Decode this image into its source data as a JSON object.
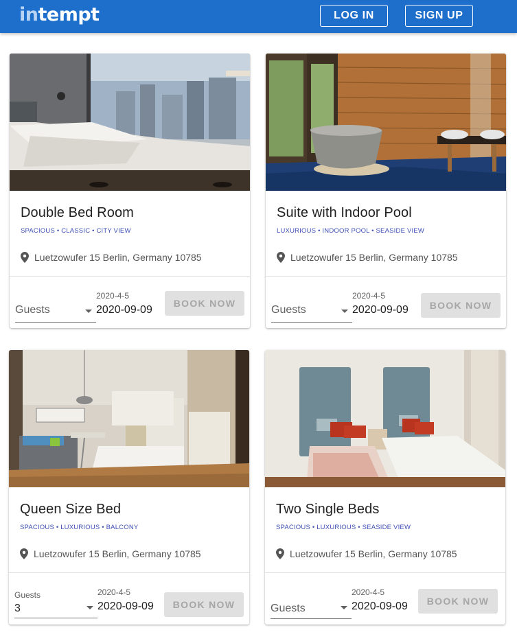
{
  "header": {
    "logo_in": "in",
    "logo_rest": "tempt",
    "login_label": "LOG IN",
    "signup_label": "SIGN UP"
  },
  "rooms": [
    {
      "title": "Double Bed Room",
      "tags": "SPACIOUS • CLASSIC • CITY VIEW",
      "address": "Luetzowufer 15 Berlin, Germany 10785",
      "guests_label": "Guests",
      "guests_value": "",
      "date_label": "2020-4-5",
      "date_value": "2020-09-09",
      "book_label": "BOOK NOW"
    },
    {
      "title": "Suite with Indoor Pool",
      "tags": "LUXURIOUS • INDOOR POOL • SEASIDE VIEW",
      "address": "Luetzowufer 15 Berlin, Germany 10785",
      "guests_label": "Guests",
      "guests_value": "",
      "date_label": "2020-4-5",
      "date_value": "2020-09-09",
      "book_label": "BOOK NOW"
    },
    {
      "title": "Queen Size Bed",
      "tags": "SPACIOUS • LUXURIOUS • BALCONY",
      "address": "Luetzowufer 15 Berlin, Germany 10785",
      "guests_label": "Guests",
      "guests_value": "3",
      "date_label": "2020-4-5",
      "date_value": "2020-09-09",
      "book_label": "BOOK NOW"
    },
    {
      "title": "Two Single Beds",
      "tags": "SPACIOUS • LUXURIOUS • SEASIDE VIEW",
      "address": "Luetzowufer 15 Berlin, Germany 10785",
      "guests_label": "Guests",
      "guests_value": "",
      "date_label": "2020-4-5",
      "date_value": "2020-09-09",
      "book_label": "BOOK NOW"
    }
  ],
  "colors": {
    "header_bg": "#1e6fcc",
    "tag_color": "#3f51b5",
    "button_disabled_bg": "#e0e0e0"
  },
  "icons": {
    "location": "location-pin-icon",
    "dropdown": "dropdown-arrow-icon"
  }
}
